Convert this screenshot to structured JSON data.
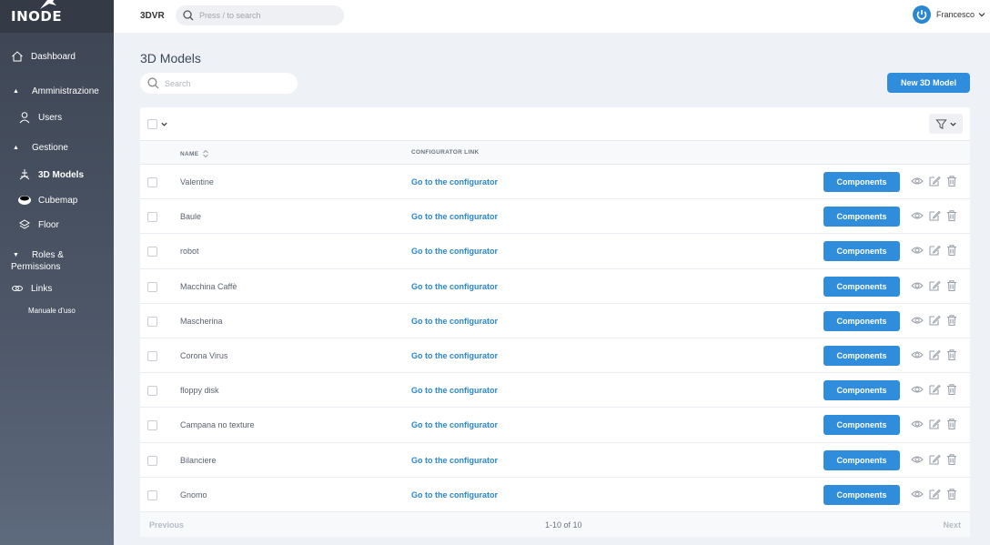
{
  "logo": {
    "text": "INODE"
  },
  "sidebar": {
    "items": [
      {
        "label": "Dashboard",
        "icon": "home-icon"
      },
      {
        "label": "Amministrazione",
        "type": "section"
      },
      {
        "label": "Users",
        "icon": "user-icon"
      },
      {
        "label": "Gestione",
        "type": "section"
      },
      {
        "label": "3D Models",
        "icon": "cube-icon",
        "active": true
      },
      {
        "label": "Cubemap",
        "icon": "cubemap-icon"
      },
      {
        "label": "Floor",
        "icon": "layers-icon"
      },
      {
        "label": "Roles &",
        "label2": "Permissions",
        "type": "section"
      },
      {
        "label": "Links",
        "icon": "link-icon"
      },
      {
        "label": "Manuale d'uso"
      }
    ]
  },
  "topbar": {
    "app_name": "3DVR",
    "search_placeholder": "Press / to search",
    "user_name": "Francesco"
  },
  "main": {
    "title": "3D Models",
    "search_placeholder": "Search",
    "new_button": "New 3D Model",
    "columns": {
      "name": "NAME",
      "link": "CONFIGURATOR LINK"
    },
    "link_text": "Go to the configurator",
    "components_label": "Components",
    "rows": [
      "Valentine",
      "Baule",
      "robot",
      "Macchina Caffè",
      "Mascherina",
      "Corona Virus",
      "floppy disk",
      "Campana no texture",
      "Bilanciere",
      "Gnomo"
    ],
    "pagination": {
      "prev": "Previous",
      "count": "1-10 of 10",
      "next": "Next"
    }
  },
  "colors": {
    "accent": "#2f8ddb",
    "link": "#2a87d0",
    "sidebar": "#4d5768"
  }
}
